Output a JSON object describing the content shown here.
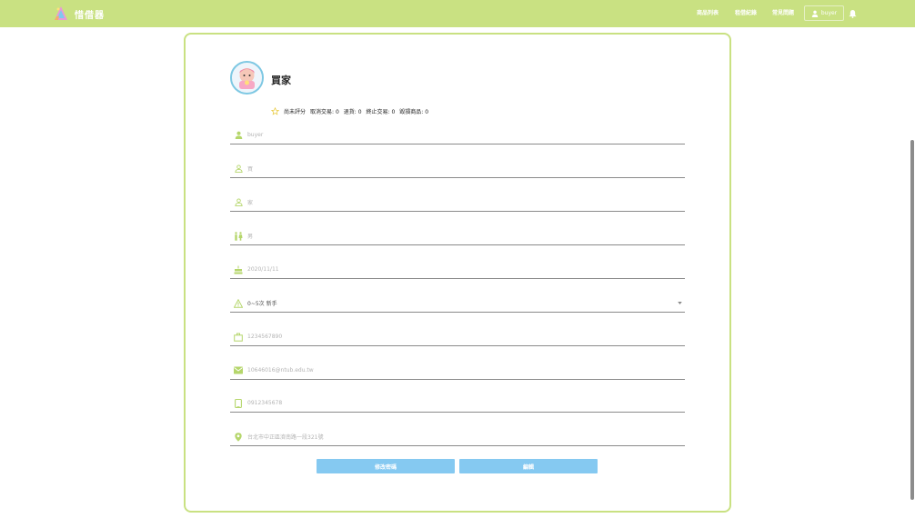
{
  "navbar": {
    "brand": "惜借器",
    "links": [
      "商品列表",
      "租借紀錄",
      "常見問題"
    ],
    "user_button": "buyer"
  },
  "profile": {
    "name": "買家",
    "stats": {
      "rating": "尚未評分",
      "cancelled": "取消交易: 0",
      "returned": "退貨: 0",
      "terminated": "終止交易: 0",
      "damaged": "毀損商品: 0"
    }
  },
  "form": {
    "username": "buyer",
    "surname": "買",
    "given_name": "家",
    "gender": "男",
    "birthday": "2020/11/11",
    "level": "0~5次 新手",
    "id_number": "1234567890",
    "email": "10646016@ntub.edu.tw",
    "phone": "0912345678",
    "address": "台北市中正區濟南路一段321號"
  },
  "buttons": {
    "change_password": "修改密碼",
    "edit": "編輯"
  },
  "colors": {
    "accent": "#c9e182",
    "icon": "#b5d66b",
    "button": "#85c9f1"
  }
}
